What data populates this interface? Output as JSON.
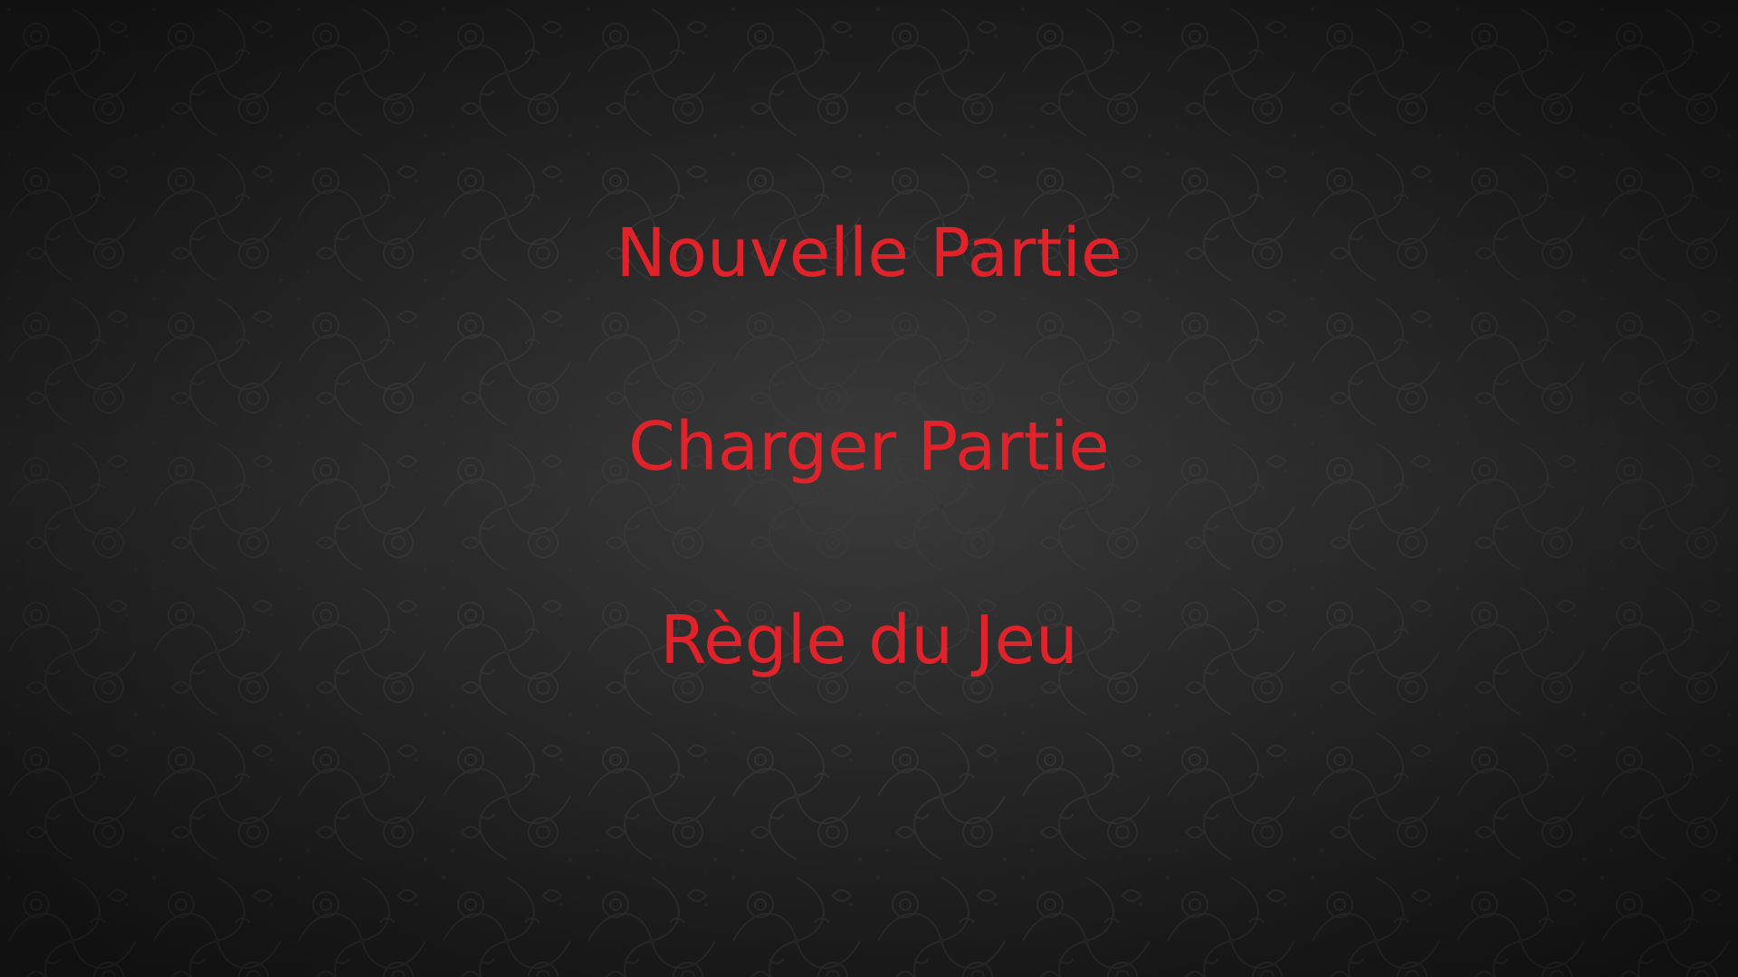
{
  "menu": {
    "items": [
      {
        "id": "new-game",
        "label": "Nouvelle Partie"
      },
      {
        "id": "load-game",
        "label": "Charger Partie"
      },
      {
        "id": "rules",
        "label": "Règle du Jeu"
      }
    ]
  },
  "theme": {
    "text_color": "#e0232a",
    "background_color": "#242424",
    "pattern_color": "#3a3a3a"
  }
}
